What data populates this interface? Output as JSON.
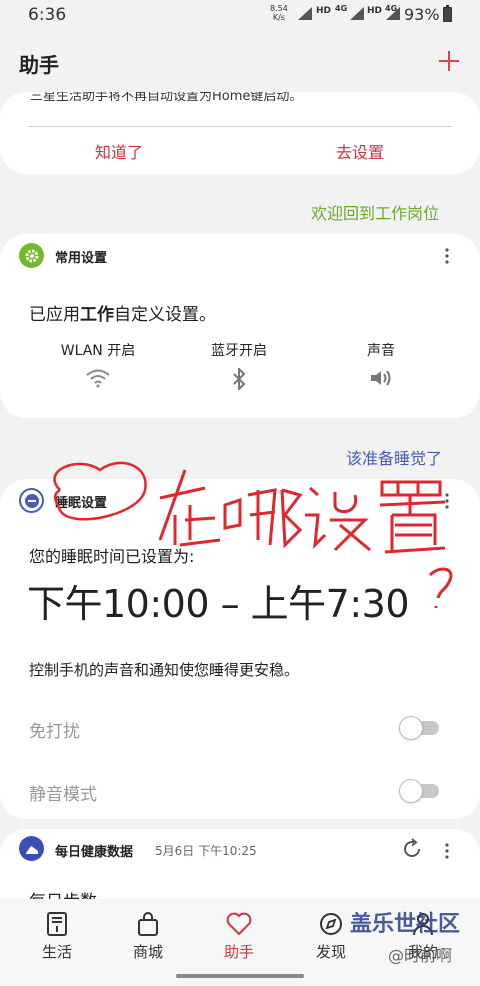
{
  "status_bar": {
    "time": "6:36",
    "net_speed": "8.54",
    "net_unit": "K/s",
    "sig1": "HD",
    "sig1b": "4G",
    "sig2": "HD",
    "sig2b": "4G",
    "battery": "93%"
  },
  "header": {
    "title": "助手"
  },
  "notice_card": {
    "message": "三星生活助手将不再自动设置为Home键启动。",
    "dismiss_label": "知道了",
    "settings_label": "去设置"
  },
  "work_link": "欢迎回到工作岗位",
  "general_card": {
    "title": "常用设置",
    "body_prefix": "已应用",
    "body_bold": "工作",
    "body_suffix": "自定义设置。",
    "quick": [
      {
        "label": "WLAN 开启"
      },
      {
        "label": "蓝牙开启"
      },
      {
        "label": "声音"
      }
    ]
  },
  "sleep_link": "该准备睡觉了",
  "sleep_card": {
    "title": "睡眠设置",
    "line1": "您的睡眠时间已设置为:",
    "time_range": "下午10:00 – 上午7:30",
    "description": "控制手机的声音和通知使您睡得更安稳。",
    "toggles": [
      {
        "label": "免打扰",
        "on": false
      },
      {
        "label": "静音模式",
        "on": false
      }
    ]
  },
  "health_card": {
    "title": "每日健康数据",
    "date": "5月6日 下午10:25",
    "steps_label": "每日步数"
  },
  "bottom_nav": [
    {
      "label": "生活",
      "active": false
    },
    {
      "label": "商城",
      "active": false
    },
    {
      "label": "助手",
      "active": true
    },
    {
      "label": "发现",
      "active": false
    },
    {
      "label": "我的",
      "active": false
    }
  ],
  "watermark": {
    "brand": "盖乐世社区",
    "user": "@时前啊"
  },
  "annotation_text": "在哪设置?",
  "colors": {
    "accent": "#d2343f",
    "green_link": "#6aaa2c",
    "blue_link": "#4a5bb8",
    "general_icon": "#74b82b",
    "sleep_icon": "#4a5bb8",
    "health_icon": "#3a4fb0",
    "annotation": "#e0262e"
  }
}
